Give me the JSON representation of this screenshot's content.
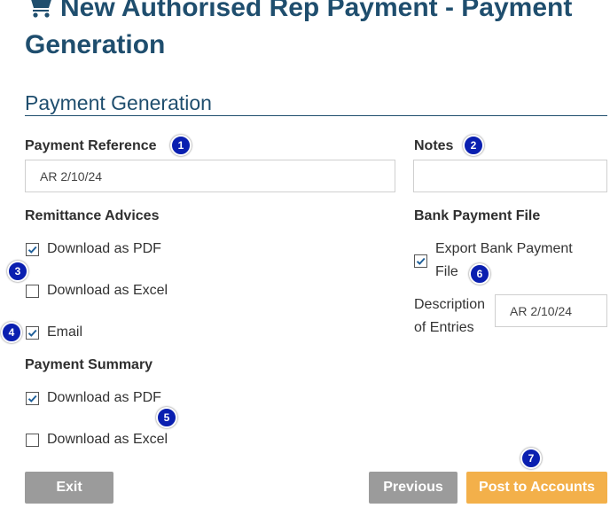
{
  "page": {
    "title": "New Authorised Rep Payment - Payment Generation",
    "title_icon": "shopping-cart-icon"
  },
  "section": {
    "title": "Payment Generation"
  },
  "payment_reference": {
    "label": "Payment Reference",
    "value": "AR 2/10/24",
    "badge": "1"
  },
  "notes": {
    "label": "Notes",
    "value": "",
    "badge": "2"
  },
  "remittance_advices": {
    "label": "Remittance Advices",
    "download_pdf": {
      "label": "Download as PDF",
      "checked": true
    },
    "download_excel": {
      "label": "Download as Excel",
      "checked": false
    },
    "email": {
      "label": "Email",
      "checked": true
    },
    "badge_excel": "3",
    "badge_email": "4"
  },
  "payment_summary": {
    "label": "Payment Summary",
    "download_pdf": {
      "label": "Download as PDF",
      "checked": true
    },
    "download_excel": {
      "label": "Download as Excel",
      "checked": false
    },
    "badge": "5"
  },
  "bank_payment_file": {
    "label": "Bank Payment File",
    "export": {
      "label_line1": "Export Bank Payment",
      "label_line2": "File",
      "checked": true
    },
    "badge": "6",
    "description": {
      "label_line1": "Description",
      "label_line2": "of Entries",
      "value": "AR 2/10/24"
    }
  },
  "buttons": {
    "exit": "Exit",
    "previous": "Previous",
    "post": "Post to Accounts",
    "post_badge": "7"
  },
  "colors": {
    "heading": "#1f4e6e",
    "badge": "#0a1fb0",
    "grey_button": "#9b9b9b",
    "orange_button": "#f3b04a",
    "checkmark": "#1f5f99"
  }
}
